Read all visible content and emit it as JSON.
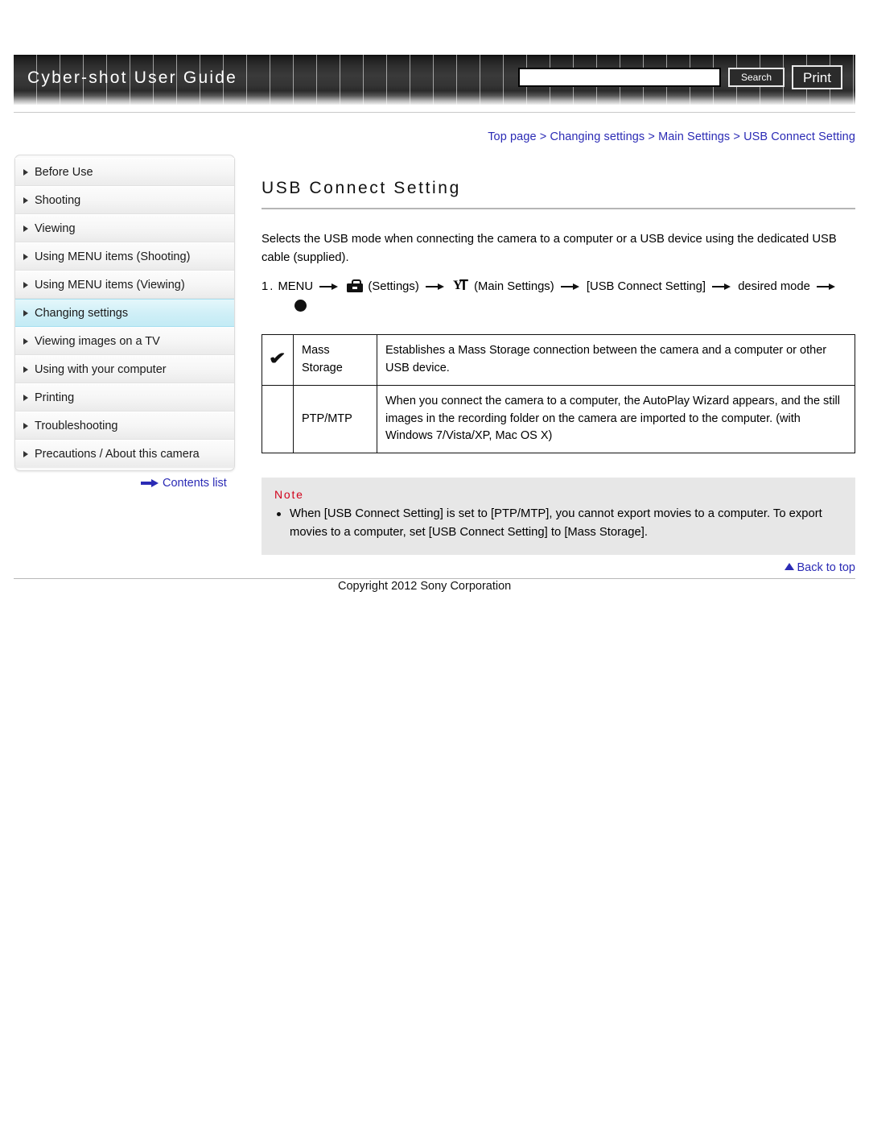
{
  "header": {
    "title": "Cyber-shot User Guide",
    "search": {
      "value": "",
      "placeholder": ""
    },
    "search_button": "Search",
    "print_button": "Print"
  },
  "breadcrumb": "Top page > Changing settings > Main Settings > USB Connect Setting",
  "sidebar": {
    "items": [
      {
        "label": "Before Use",
        "active": false
      },
      {
        "label": "Shooting",
        "active": false
      },
      {
        "label": "Viewing",
        "active": false
      },
      {
        "label": "Using MENU items (Shooting)",
        "active": false
      },
      {
        "label": "Using MENU items (Viewing)",
        "active": false
      },
      {
        "label": "Changing settings",
        "active": true
      },
      {
        "label": "Viewing images on a TV",
        "active": false
      },
      {
        "label": "Using with your computer",
        "active": false
      },
      {
        "label": "Printing",
        "active": false
      },
      {
        "label": "Troubleshooting",
        "active": false
      },
      {
        "label": "Precautions / About this camera",
        "active": false
      }
    ],
    "contents_list_link": "Contents list"
  },
  "main": {
    "page_title": "USB Connect Setting",
    "intro": "Selects the USB mode when connecting the camera to a computer or a USB device using the dedicated USB cable (supplied).",
    "step": {
      "number": "1.",
      "seg1": "MENU",
      "seg2": "(Settings)",
      "seg3": "(Main Settings)",
      "seg4": "[USB Connect Setting]",
      "seg5": "desired mode",
      "icon_settings": "toolbox-icon",
      "icon_main_settings": "wrench-icon",
      "end_dot": "enter-button-dot"
    },
    "table": {
      "rows": [
        {
          "checked": "✔",
          "label": "Mass Storage",
          "description": "Establishes a Mass Storage connection between the camera and a computer or other USB device."
        },
        {
          "checked": "",
          "label": "PTP/MTP",
          "description": "When you connect the camera to a computer, the AutoPlay Wizard appears, and the still images in the recording folder on the camera are imported to the computer. (with Windows 7/Vista/XP, Mac OS X)"
        }
      ]
    },
    "note": {
      "title": "Note",
      "items": [
        "When [USB Connect Setting] is set to [PTP/MTP], you cannot export movies to a computer. To export movies to a computer, set [USB Connect Setting] to [Mass Storage]."
      ]
    }
  },
  "footer": {
    "back_to_top": "Back to top",
    "copyright": "Copyright 2012 Sony Corporation"
  },
  "colors": {
    "link": "#2b2bb5",
    "note_title": "#d1021b",
    "active_nav": "#cfeff7"
  }
}
